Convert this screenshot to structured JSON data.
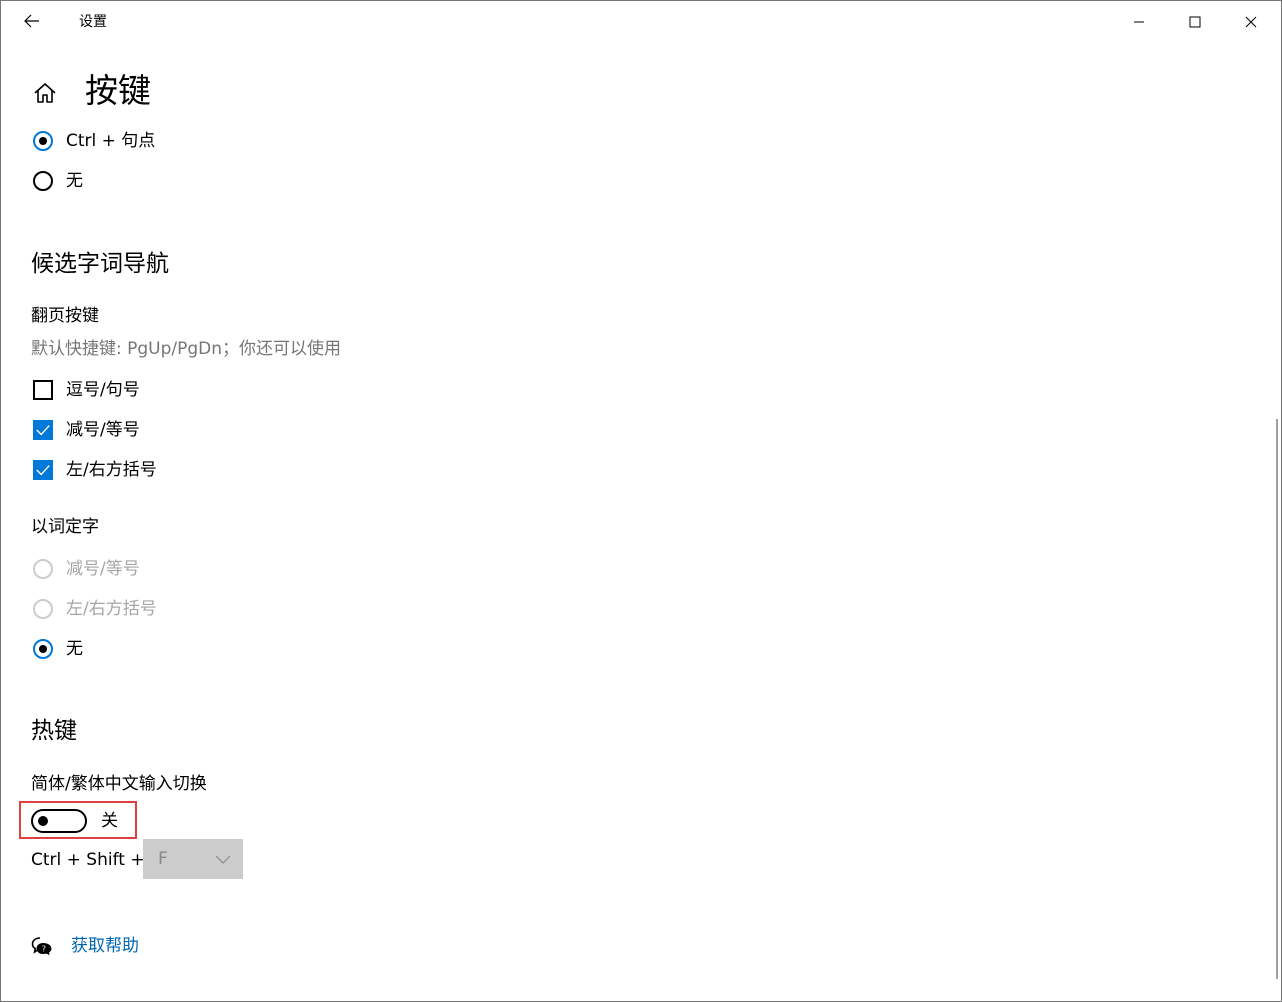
{
  "window": {
    "title": "设置"
  },
  "header": {
    "title": "按键"
  },
  "partial_group": {
    "options": [
      {
        "label": "Ctrl + 句点",
        "checked": true
      },
      {
        "label": "无",
        "checked": false
      }
    ]
  },
  "candidate_nav": {
    "title": "候选字词导航",
    "page_keys": {
      "label": "翻页按键",
      "description": "默认快捷键: PgUp/PgDn；你还可以使用",
      "options": [
        {
          "label": "逗号/句号",
          "checked": false
        },
        {
          "label": "减号/等号",
          "checked": true
        },
        {
          "label": "左/右方括号",
          "checked": true
        }
      ]
    },
    "word_select": {
      "label": "以词定字",
      "options": [
        {
          "label": "减号/等号",
          "checked": false,
          "disabled": true
        },
        {
          "label": "左/右方括号",
          "checked": false,
          "disabled": true
        },
        {
          "label": "无",
          "checked": true,
          "disabled": false
        }
      ]
    }
  },
  "hotkeys": {
    "title": "热键",
    "switch": {
      "label": "简体/繁体中文输入切换",
      "state": "关",
      "on": false
    },
    "combo": {
      "prefix": "Ctrl + Shift +",
      "key": "F"
    }
  },
  "help": {
    "label": "获取帮助"
  },
  "icons": {
    "back": "back-arrow-icon",
    "home": "home-icon",
    "minimize": "minimize-icon",
    "maximize": "maximize-icon",
    "close": "close-icon",
    "help": "chat-help-icon",
    "chevron": "chevron-down-icon",
    "check": "checkmark-icon"
  },
  "colors": {
    "accent": "#0078d7",
    "link": "#0066b4",
    "highlight": "#e04040",
    "disabled": "#a6a6a6"
  }
}
